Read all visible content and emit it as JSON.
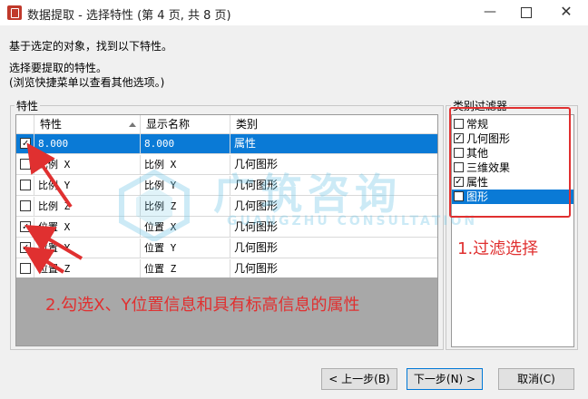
{
  "window": {
    "title": "数据提取 - 选择特性 (第 4 页, 共 8 页)",
    "minimize_glyph": "—",
    "close_glyph": "✕"
  },
  "intro": {
    "line1": "基于选定的对象，找到以下特性。",
    "line2": "选择要提取的特性。",
    "line3": "(浏览快捷菜单以查看其他选项。)"
  },
  "properties_group": {
    "label": "特性",
    "columns": [
      "特性",
      "显示名称",
      "类别"
    ],
    "rows": [
      {
        "checked": true,
        "property": "8.000",
        "display": "8.000",
        "category": "属性",
        "selected": true
      },
      {
        "checked": false,
        "property": "比例 X",
        "display": "比例 X",
        "category": "几何图形",
        "selected": false
      },
      {
        "checked": false,
        "property": "比例 Y",
        "display": "比例 Y",
        "category": "几何图形",
        "selected": false
      },
      {
        "checked": false,
        "property": "比例 Z",
        "display": "比例 Z",
        "category": "几何图形",
        "selected": false
      },
      {
        "checked": true,
        "property": "位置 X",
        "display": "位置 X",
        "category": "几何图形",
        "selected": false
      },
      {
        "checked": true,
        "property": "位置 Y",
        "display": "位置 Y",
        "category": "几何图形",
        "selected": false
      },
      {
        "checked": false,
        "property": "位置 Z",
        "display": "位置 Z",
        "category": "几何图形",
        "selected": false
      }
    ]
  },
  "filter_group": {
    "label": "类别过滤器",
    "items": [
      {
        "label": "常规",
        "checked": false,
        "selected": false
      },
      {
        "label": "几何图形",
        "checked": true,
        "selected": false
      },
      {
        "label": "其他",
        "checked": false,
        "selected": false
      },
      {
        "label": "三维效果",
        "checked": false,
        "selected": false
      },
      {
        "label": "属性",
        "checked": true,
        "selected": false
      },
      {
        "label": "图形",
        "checked": false,
        "selected": true
      }
    ]
  },
  "buttons": {
    "back": "< 上一步(B)",
    "next": "下一步(N) >",
    "cancel": "取消(C)"
  },
  "annotations": {
    "filter_note": "1.过滤选择",
    "check_note": "2.勾选X、Y位置信息和具有标高信息的属性",
    "color": "#e03030"
  },
  "watermark": {
    "cn": "广筑咨询",
    "en": "GUANGZHU CONSULTATION"
  },
  "check_glyph": "✓"
}
